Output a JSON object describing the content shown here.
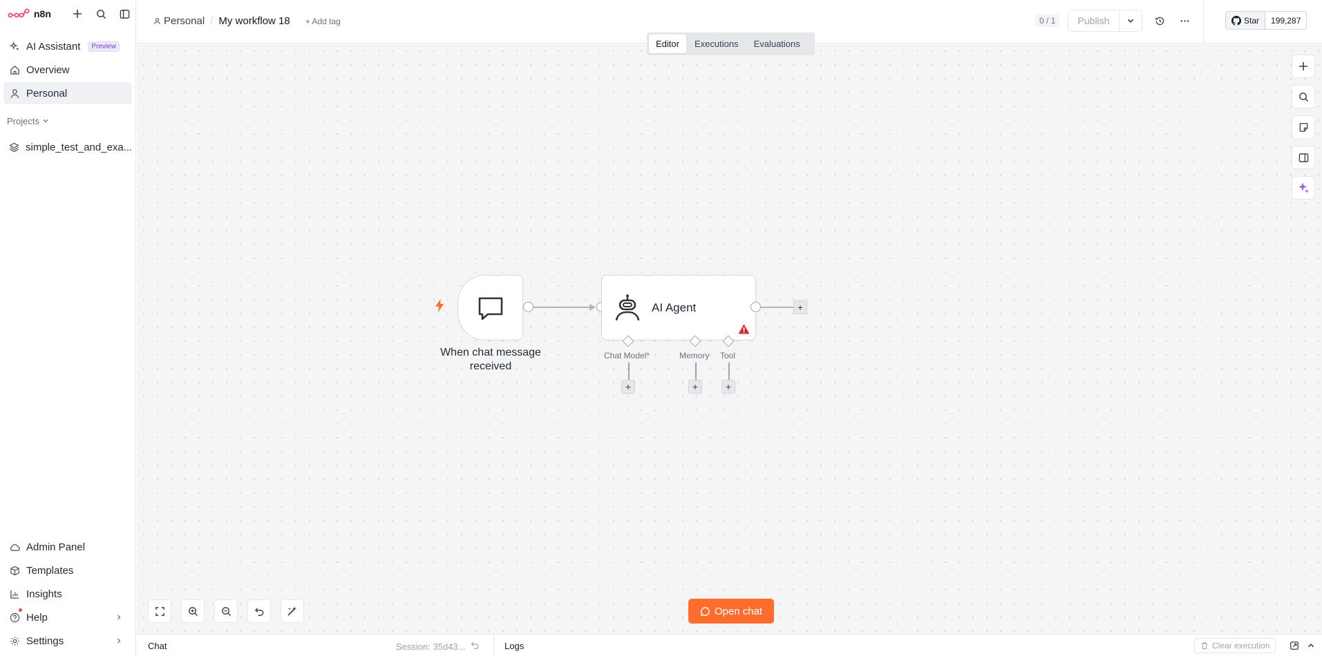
{
  "app": {
    "name": "n8n"
  },
  "sidebar": {
    "nav": [
      {
        "label": "AI Assistant",
        "badge": "Preview"
      },
      {
        "label": "Overview"
      },
      {
        "label": "Personal"
      }
    ],
    "projects_label": "Projects",
    "projects": [
      {
        "label": "simple_test_and_exa..."
      }
    ],
    "bottom": [
      {
        "label": "Admin Panel"
      },
      {
        "label": "Templates"
      },
      {
        "label": "Insights"
      },
      {
        "label": "Help"
      },
      {
        "label": "Settings"
      }
    ]
  },
  "header": {
    "project": "Personal",
    "workflow_title": "My workflow 18",
    "add_tag": "+ Add tag",
    "counter": "0 / 1",
    "publish_label": "Publish",
    "github": {
      "star_label": "Star",
      "count": "199,287"
    }
  },
  "tabs": [
    {
      "label": "Editor",
      "active": true
    },
    {
      "label": "Executions"
    },
    {
      "label": "Evaluations"
    }
  ],
  "canvas": {
    "trigger_node": {
      "caption_line1": "When chat message",
      "caption_line2": "received"
    },
    "agent_node": {
      "label": "AI Agent",
      "inputs": [
        {
          "label": "Chat Model",
          "required": "*"
        },
        {
          "label": "Memory"
        },
        {
          "label": "Tool"
        }
      ]
    },
    "open_chat_label": "Open chat"
  },
  "bottom_bar": {
    "chat_label": "Chat",
    "session": "Session: 35d43...",
    "logs_label": "Logs",
    "clear_execution": "Clear execution"
  },
  "colors": {
    "accent": "#ff6d2c",
    "brand": "#ea4b71",
    "warning": "#dc2626",
    "ai_purple": "#9b5de5"
  }
}
